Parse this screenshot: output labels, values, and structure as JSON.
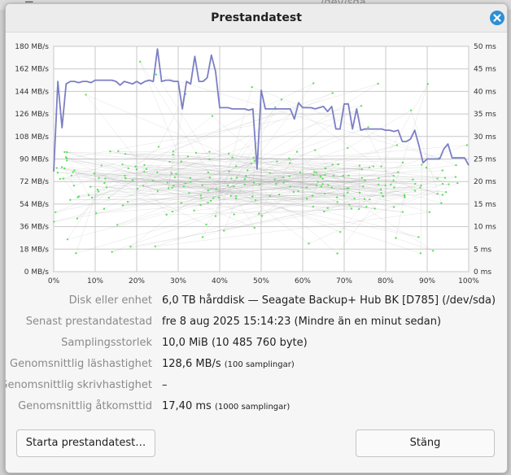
{
  "background": {
    "device_path": "/dev/sda"
  },
  "dialog": {
    "title": "Prestandatest",
    "close_icon": "close-icon"
  },
  "colors": {
    "read_line": "#7b7fc4",
    "access_points": "#5ee05e",
    "close_button": "#2d8fd5"
  },
  "chart_data": {
    "type": "line",
    "x_ticks": [
      "0%",
      "10%",
      "20%",
      "30%",
      "40%",
      "50%",
      "60%",
      "70%",
      "80%",
      "90%",
      "100%"
    ],
    "y_left_ticks": [
      "0 MB/s",
      "18 MB/s",
      "36 MB/s",
      "54 MB/s",
      "72 MB/s",
      "90 MB/s",
      "108 MB/s",
      "126 MB/s",
      "144 MB/s",
      "162 MB/s",
      "180 MB/s"
    ],
    "y_right_ticks": [
      "0 ms",
      "5 ms",
      "10 ms",
      "15 ms",
      "20 ms",
      "25 ms",
      "30 ms",
      "35 ms",
      "40 ms",
      "45 ms",
      "50 ms"
    ],
    "xlim": [
      0,
      100
    ],
    "ylim_left": [
      0,
      180
    ],
    "ylim_right": [
      0,
      50
    ],
    "grid": true,
    "read_series": {
      "x": [
        0,
        1,
        2,
        3,
        4,
        5,
        6,
        7,
        8,
        9,
        10,
        11,
        12,
        13,
        14,
        15,
        16,
        17,
        18,
        19,
        20,
        21,
        22,
        23,
        24,
        25,
        26,
        27,
        28,
        29,
        30,
        31,
        32,
        33,
        34,
        35,
        36,
        37,
        38,
        39,
        40,
        41,
        42,
        43,
        44,
        45,
        46,
        47,
        48,
        49,
        50,
        51,
        52,
        53,
        54,
        55,
        56,
        57,
        58,
        59,
        60,
        61,
        62,
        63,
        64,
        65,
        66,
        67,
        68,
        69,
        70,
        71,
        72,
        73,
        74,
        75,
        76,
        77,
        78,
        79,
        80,
        81,
        82,
        83,
        84,
        85,
        86,
        87,
        88,
        89,
        90,
        91,
        92,
        93,
        94,
        95,
        96,
        97,
        98,
        99,
        100
      ],
      "y": [
        80,
        152,
        115,
        150,
        152,
        152,
        151,
        152,
        152,
        151,
        153,
        153,
        153,
        153,
        153,
        152,
        149,
        152,
        151,
        150,
        152,
        150,
        152,
        153,
        152,
        178,
        152,
        153,
        153,
        152,
        152,
        130,
        152,
        150,
        172,
        152,
        152,
        155,
        173,
        160,
        131,
        131,
        131,
        130,
        130,
        130,
        130,
        129,
        130,
        82,
        145,
        130,
        130,
        130,
        130,
        130,
        130,
        130,
        122,
        135,
        131,
        131,
        131,
        130,
        131,
        132,
        128,
        132,
        114,
        114,
        134,
        134,
        114,
        130,
        113,
        114,
        114,
        114,
        114,
        114,
        113,
        113,
        112,
        113,
        104,
        104,
        106,
        113,
        101,
        87,
        90,
        90,
        90,
        90,
        98,
        102,
        91,
        91,
        91,
        91,
        85
      ]
    },
    "access_time_ms": {
      "count": 1000,
      "typical_range": [
        10,
        30
      ]
    }
  },
  "info": {
    "disk": {
      "label": "Disk eller enhet",
      "value": "6,0 TB hårddisk — Seagate Backup+ Hub BK [D785] (/dev/sda)"
    },
    "last_test": {
      "label": "Senast prestandatestad",
      "value": "fre   8 aug 2025 15:14:23 (Mindre än en minut sedan)"
    },
    "sample_size": {
      "label": "Samplingsstorlek",
      "value": "10,0 MiB (10 485 760 byte)"
    },
    "avg_read": {
      "label": "Genomsnittlig läshastighet",
      "value": "128,6 MB/s",
      "note": "(100 samplingar)"
    },
    "avg_write": {
      "label": "Genomsnittlig skrivhastighet",
      "value": "–"
    },
    "avg_access": {
      "label": "Genomsnittlig åtkomsttid",
      "value": "17,40 ms",
      "note": "(1000 samplingar)"
    }
  },
  "buttons": {
    "start": "Starta prestandatest…",
    "close": "Stäng"
  }
}
